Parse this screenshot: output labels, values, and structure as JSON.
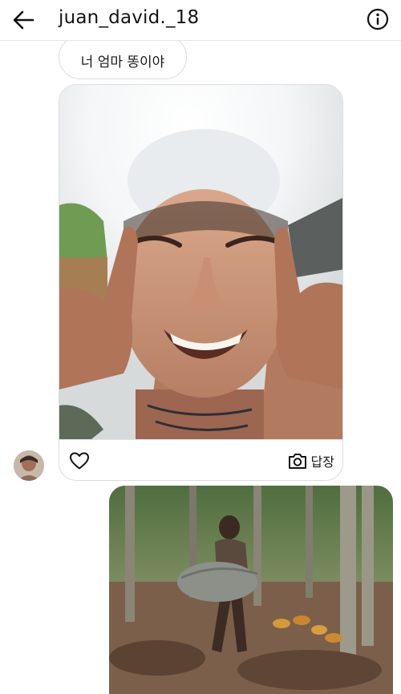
{
  "header": {
    "title": "juan_david._18",
    "back_icon": "arrow-left-icon",
    "info_icon": "info-circle-icon"
  },
  "messages": [
    {
      "type": "text",
      "text": "너 엄마 똥이야"
    },
    {
      "type": "photo",
      "from": "other",
      "actions": {
        "like_icon": "heart-icon",
        "reply_icon": "camera-icon",
        "reply_label": "답장"
      }
    },
    {
      "type": "photo",
      "from": "me"
    }
  ],
  "colors": {
    "bubble_border": "#dcdcdc",
    "text": "#111111",
    "background": "#ffffff"
  }
}
